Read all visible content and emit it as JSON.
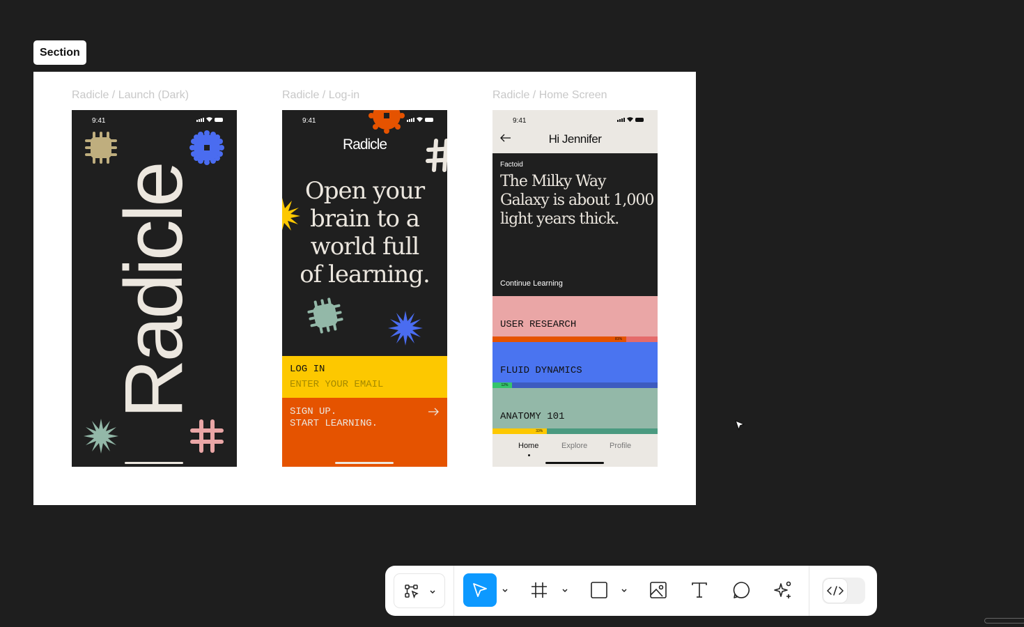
{
  "section": {
    "label": "Section"
  },
  "frames": [
    {
      "title": "Radicle / Launch (Dark)"
    },
    {
      "title": "Radicle / Log-in"
    },
    {
      "title": "Radicle / Home Screen"
    }
  ],
  "launch": {
    "time": "9:41",
    "wordmark": "Radicle"
  },
  "login": {
    "time": "9:41",
    "brand": "Radicle",
    "headline": [
      "Open your",
      "brain to a",
      "world full",
      "of learning."
    ],
    "login_label": "LOG IN",
    "email_placeholder": "ENTER YOUR EMAIL",
    "signup_line1": "SIGN UP.",
    "signup_line2": "START LEARNING."
  },
  "home": {
    "time": "9:41",
    "greeting": "Hi Jennifer",
    "factoid_label": "Factoid",
    "factoid_text": [
      "The Milky Way",
      "Galaxy is about 1,000",
      "light years thick."
    ],
    "continue": "Continue Learning",
    "courses": [
      {
        "name": "USER RESEARCH",
        "progress": 0.81,
        "pct_label": "81%",
        "bg": "#eaa6a6",
        "fill": "#e55300",
        "track": "#e56b6b"
      },
      {
        "name": "FLUID DYNAMICS",
        "progress": 0.12,
        "pct_label": "12%",
        "bg": "#4a74f0",
        "fill": "#35c46b",
        "track": "#3d5bbf"
      },
      {
        "name": "ANATOMY 101",
        "progress": 0.33,
        "pct_label": "33%",
        "bg": "#93b8a8",
        "fill": "#fdc800",
        "track": "#4a9a80"
      }
    ],
    "tabs": [
      "Home",
      "Explore",
      "Profile"
    ]
  },
  "toolbar": {
    "tools": [
      "move-tool",
      "frame-tool",
      "shape-tool",
      "image-tool",
      "text-tool",
      "comment-tool",
      "ai-tool",
      "dev-mode"
    ],
    "active": "move-tool",
    "accent": "#0d99ff"
  }
}
